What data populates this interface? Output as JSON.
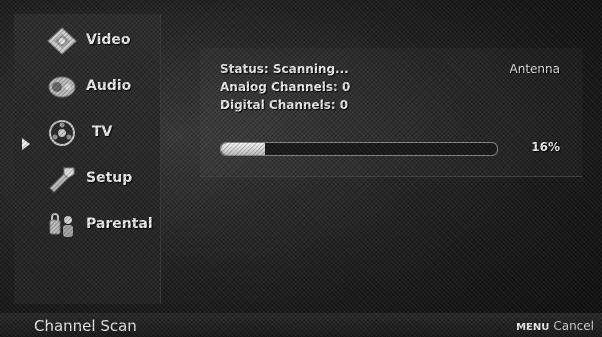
{
  "menu": {
    "items": [
      {
        "label": "Video",
        "icon": "video-icon"
      },
      {
        "label": "Audio",
        "icon": "audio-icon"
      },
      {
        "label": "TV",
        "icon": "tv-icon",
        "selected": true
      },
      {
        "label": "Setup",
        "icon": "setup-icon"
      },
      {
        "label": "Parental",
        "icon": "parental-icon"
      }
    ]
  },
  "scan": {
    "status": "Status: Scanning...",
    "analog": "Analog Channels: 0",
    "digital": "Digital Channels: 0",
    "source": "Antenna",
    "progress_fraction": 0.16,
    "progress_text": "16%"
  },
  "footer": {
    "title": "Channel Scan",
    "key": "MENU",
    "action": "Cancel"
  }
}
